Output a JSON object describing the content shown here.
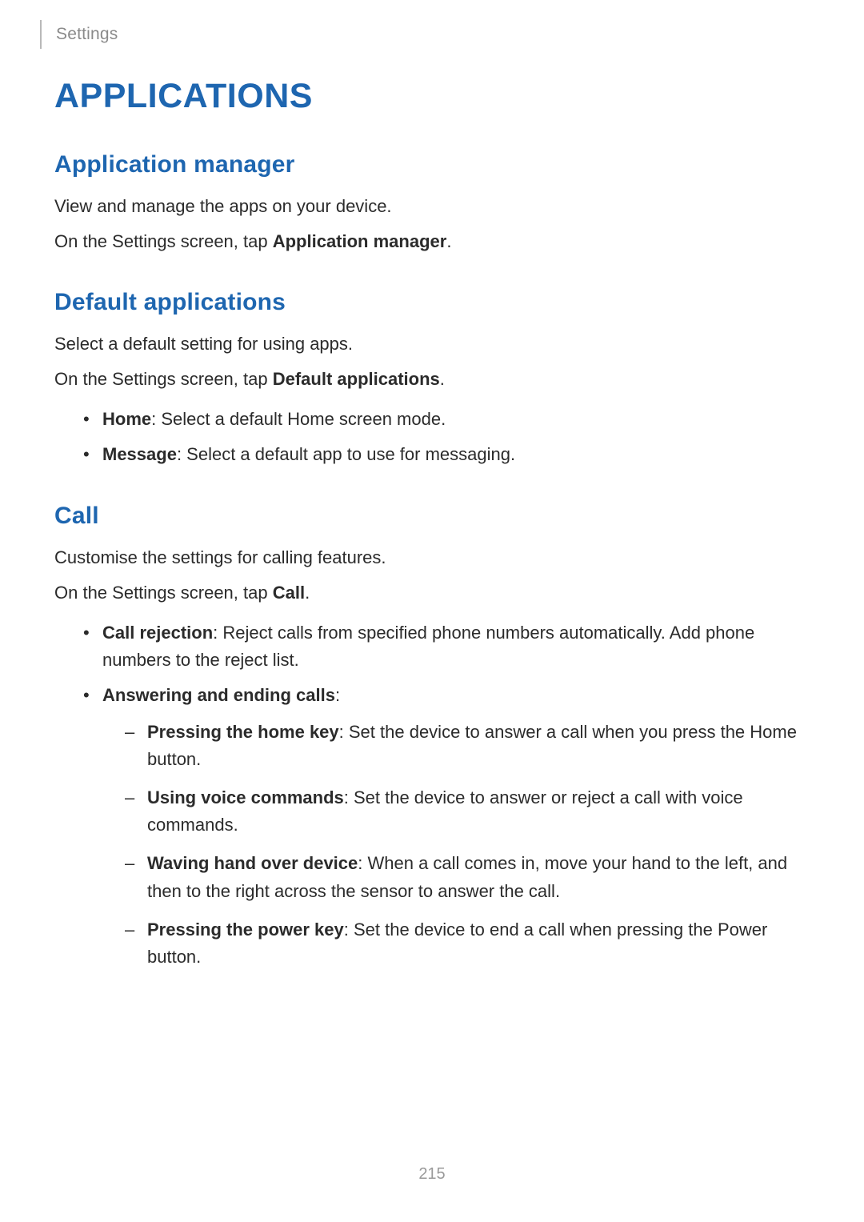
{
  "running_head": "Settings",
  "page_title": "APPLICATIONS",
  "page_number": "215",
  "sections": {
    "app_manager": {
      "title": "Application manager",
      "p1": "View and manage the apps on your device.",
      "p2_prefix": "On the Settings screen, tap ",
      "p2_bold": "Application manager",
      "p2_suffix": "."
    },
    "default_apps": {
      "title": "Default applications",
      "p1": "Select a default setting for using apps.",
      "p2_prefix": "On the Settings screen, tap ",
      "p2_bold": "Default applications",
      "p2_suffix": ".",
      "items": [
        {
          "bold": "Home",
          "text": ": Select a default Home screen mode."
        },
        {
          "bold": "Message",
          "text": ": Select a default app to use for messaging."
        }
      ]
    },
    "call": {
      "title": "Call",
      "p1": "Customise the settings for calling features.",
      "p2_prefix": "On the Settings screen, tap ",
      "p2_bold": "Call",
      "p2_suffix": ".",
      "items": [
        {
          "bold": "Call rejection",
          "text": ": Reject calls from specified phone numbers automatically. Add phone numbers to the reject list."
        },
        {
          "bold": "Answering and ending calls",
          "text": ":",
          "subitems": [
            {
              "bold": "Pressing the home key",
              "text": ": Set the device to answer a call when you press the Home button."
            },
            {
              "bold": "Using voice commands",
              "text": ": Set the device to answer or reject a call with voice commands."
            },
            {
              "bold": "Waving hand over device",
              "text": ": When a call comes in, move your hand to the left, and then to the right across the sensor to answer the call."
            },
            {
              "bold": "Pressing the power key",
              "text": ": Set the device to end a call when pressing the Power button."
            }
          ]
        }
      ]
    }
  }
}
